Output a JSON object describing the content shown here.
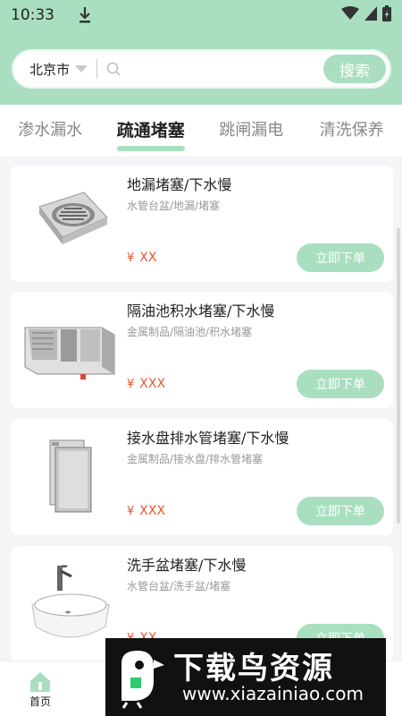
{
  "status": {
    "time": "10:33"
  },
  "search": {
    "city": "北京市",
    "placeholder": "",
    "button_label": "搜索"
  },
  "tabs": [
    {
      "label": "渗水漏水",
      "active": false
    },
    {
      "label": "疏通堵塞",
      "active": true
    },
    {
      "label": "跳闸漏电",
      "active": false
    },
    {
      "label": "清洗保养",
      "active": false
    }
  ],
  "products": [
    {
      "title": "地漏堵塞/下水慢",
      "subtitle": "水管台盆/地漏/堵塞",
      "currency": "¥",
      "price": "XX",
      "button": "立即下单",
      "icon": "floor-drain-image"
    },
    {
      "title": "隔油池积水堵塞/下水慢",
      "subtitle": "金属制品/隔油池/积水堵塞",
      "currency": "¥",
      "price": "XXX",
      "button": "立即下单",
      "icon": "grease-trap-image"
    },
    {
      "title": "接水盘排水管堵塞/下水慢",
      "subtitle": "金属制品/接水盘/排水管堵塞",
      "currency": "¥",
      "price": "XXX",
      "button": "立即下单",
      "icon": "drip-tray-image"
    },
    {
      "title": "洗手盆堵塞/下水慢",
      "subtitle": "水管台盆/洗手盆/堵塞",
      "currency": "¥",
      "price": "XX",
      "button": "立即下单",
      "icon": "washbasin-image"
    }
  ],
  "bottom_nav": {
    "home_label": "首页"
  },
  "watermark": {
    "title": "下载鸟资源",
    "url": "www.xiazainiao.com"
  },
  "colors": {
    "accent": "#a9dfc0",
    "price": "#e2572c"
  }
}
